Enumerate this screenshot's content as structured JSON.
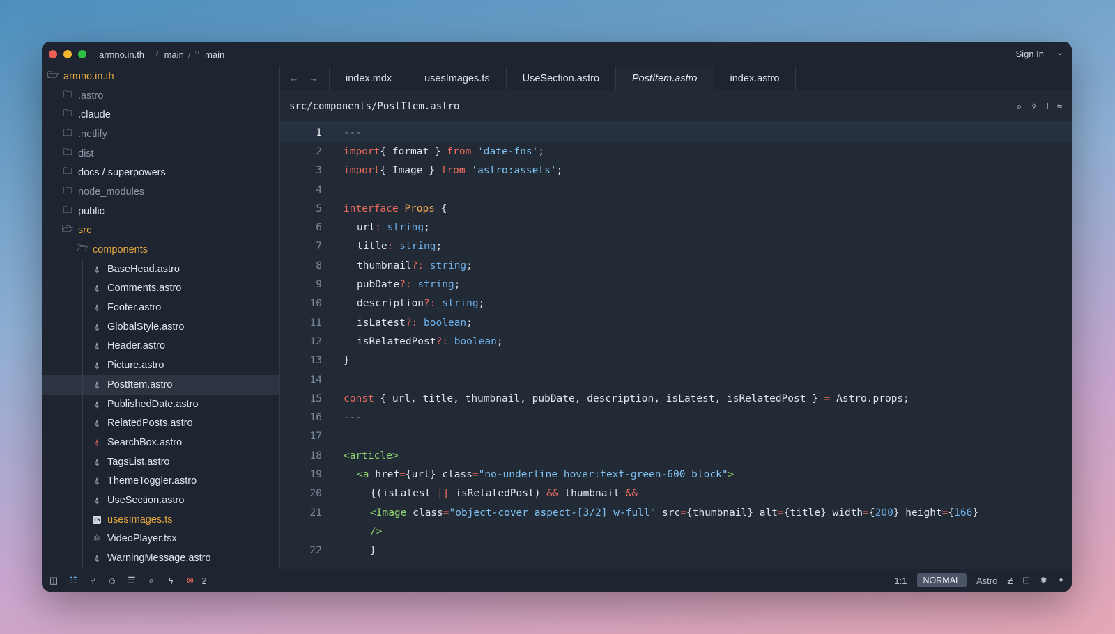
{
  "window": {
    "traffic_lights": [
      "#ed5f56",
      "#f2b92d",
      "#2fbf47"
    ],
    "project": "armno.in.th",
    "branch1": "main",
    "branch_sep": "/",
    "branch2": "main",
    "sign_in": "Sign In"
  },
  "sidebar": {
    "root": "armno.in.th",
    "items": [
      {
        "label": ".astro",
        "kind": "folder",
        "style": "muted"
      },
      {
        "label": ".claude",
        "kind": "folder"
      },
      {
        "label": ".netlify",
        "kind": "folder",
        "style": "muted"
      },
      {
        "label": "dist",
        "kind": "folder",
        "style": "muted"
      },
      {
        "label": "docs / superpowers",
        "kind": "folder"
      },
      {
        "label": "node_modules",
        "kind": "folder",
        "style": "muted"
      },
      {
        "label": "public",
        "kind": "folder"
      },
      {
        "label": "src",
        "kind": "folder-open",
        "style": "orange"
      },
      {
        "label": "components",
        "kind": "folder-open",
        "style": "orange"
      },
      {
        "label": "BaseHead.astro",
        "kind": "astro"
      },
      {
        "label": "Comments.astro",
        "kind": "astro"
      },
      {
        "label": "Footer.astro",
        "kind": "astro"
      },
      {
        "label": "GlobalStyle.astro",
        "kind": "astro"
      },
      {
        "label": "Header.astro",
        "kind": "astro"
      },
      {
        "label": "Picture.astro",
        "kind": "astro"
      },
      {
        "label": "PostItem.astro",
        "kind": "astro",
        "selected": true
      },
      {
        "label": "PublishedDate.astro",
        "kind": "astro"
      },
      {
        "label": "RelatedPosts.astro",
        "kind": "astro"
      },
      {
        "label": "SearchBox.astro",
        "kind": "astro-error"
      },
      {
        "label": "TagsList.astro",
        "kind": "astro"
      },
      {
        "label": "ThemeToggler.astro",
        "kind": "astro"
      },
      {
        "label": "UseSection.astro",
        "kind": "astro"
      },
      {
        "label": "usesImages.ts",
        "kind": "ts",
        "style": "orange"
      },
      {
        "label": "VideoPlayer.tsx",
        "kind": "react"
      },
      {
        "label": "WarningMessage.astro",
        "kind": "astro"
      }
    ]
  },
  "tabs": [
    {
      "label": "index.mdx"
    },
    {
      "label": "usesImages.ts"
    },
    {
      "label": "UseSection.astro"
    },
    {
      "label": "PostItem.astro",
      "active": true
    },
    {
      "label": "index.astro"
    }
  ],
  "breadcrumb": "src/components/PostItem.astro",
  "code": [
    {
      "n": "1",
      "indent": 0,
      "tokens": [
        [
          "dim",
          "---"
        ]
      ],
      "current": true
    },
    {
      "n": "2",
      "indent": 0,
      "tokens": [
        [
          "kw",
          "import"
        ],
        [
          "",
          "{ format } "
        ],
        [
          "kw",
          "from"
        ],
        [
          "",
          " "
        ],
        [
          "str",
          "'date-fns'"
        ],
        [
          "",
          ";"
        ]
      ]
    },
    {
      "n": "3",
      "indent": 0,
      "tokens": [
        [
          "kw",
          "import"
        ],
        [
          "",
          "{ Image } "
        ],
        [
          "kw",
          "from"
        ],
        [
          "",
          " "
        ],
        [
          "str",
          "'astro:assets'"
        ],
        [
          "",
          ";"
        ]
      ]
    },
    {
      "n": "4",
      "indent": 0,
      "tokens": []
    },
    {
      "n": "5",
      "indent": 0,
      "tokens": [
        [
          "kw",
          "interface"
        ],
        [
          "",
          " "
        ],
        [
          "cls",
          "Props"
        ],
        [
          "",
          " {"
        ]
      ]
    },
    {
      "n": "6",
      "indent": 1,
      "tokens": [
        [
          "",
          "url"
        ],
        [
          "op",
          ":"
        ],
        [
          "",
          " "
        ],
        [
          "typ",
          "string"
        ],
        [
          "",
          ";"
        ]
      ]
    },
    {
      "n": "7",
      "indent": 1,
      "tokens": [
        [
          "",
          "title"
        ],
        [
          "op",
          ":"
        ],
        [
          "",
          " "
        ],
        [
          "typ",
          "string"
        ],
        [
          "",
          ";"
        ]
      ]
    },
    {
      "n": "8",
      "indent": 1,
      "tokens": [
        [
          "",
          "thumbnail"
        ],
        [
          "op",
          "?:"
        ],
        [
          "",
          " "
        ],
        [
          "typ",
          "string"
        ],
        [
          "",
          ";"
        ]
      ]
    },
    {
      "n": "9",
      "indent": 1,
      "tokens": [
        [
          "",
          "pubDate"
        ],
        [
          "op",
          "?:"
        ],
        [
          "",
          " "
        ],
        [
          "typ",
          "string"
        ],
        [
          "",
          ";"
        ]
      ]
    },
    {
      "n": "10",
      "indent": 1,
      "tokens": [
        [
          "",
          "description"
        ],
        [
          "op",
          "?:"
        ],
        [
          "",
          " "
        ],
        [
          "typ",
          "string"
        ],
        [
          "",
          ";"
        ]
      ]
    },
    {
      "n": "11",
      "indent": 1,
      "tokens": [
        [
          "",
          "isLatest"
        ],
        [
          "op",
          "?:"
        ],
        [
          "",
          " "
        ],
        [
          "typ",
          "boolean"
        ],
        [
          "",
          ";"
        ]
      ]
    },
    {
      "n": "12",
      "indent": 1,
      "tokens": [
        [
          "",
          "isRelatedPost"
        ],
        [
          "op",
          "?:"
        ],
        [
          "",
          " "
        ],
        [
          "typ",
          "boolean"
        ],
        [
          "",
          ";"
        ]
      ]
    },
    {
      "n": "13",
      "indent": 0,
      "tokens": [
        [
          "",
          "}"
        ]
      ]
    },
    {
      "n": "14",
      "indent": 0,
      "tokens": []
    },
    {
      "n": "15",
      "indent": 0,
      "tokens": [
        [
          "kw",
          "const"
        ],
        [
          "",
          " { url, title, thumbnail, pubDate, description, isLatest, isRelatedPost } "
        ],
        [
          "op",
          "="
        ],
        [
          "",
          " Astro.props;"
        ]
      ]
    },
    {
      "n": "16",
      "indent": 0,
      "tokens": [
        [
          "dim",
          "---"
        ]
      ]
    },
    {
      "n": "17",
      "indent": 0,
      "tokens": []
    },
    {
      "n": "18",
      "indent": 0,
      "tokens": [
        [
          "tag",
          "<article>"
        ]
      ]
    },
    {
      "n": "19",
      "indent": 1,
      "tokens": [
        [
          "tag",
          "<a"
        ],
        [
          "",
          " href"
        ],
        [
          "op",
          "="
        ],
        [
          "",
          "{url} class"
        ],
        [
          "op",
          "="
        ],
        [
          "str",
          "\"no-underline hover:text-green-600 block\""
        ],
        [
          "tag",
          ">"
        ]
      ]
    },
    {
      "n": "20",
      "indent": 2,
      "tokens": [
        [
          "",
          "{(isLatest "
        ],
        [
          "op",
          "||"
        ],
        [
          "",
          " isRelatedPost) "
        ],
        [
          "op",
          "&&"
        ],
        [
          "",
          " thumbnail "
        ],
        [
          "op",
          "&&"
        ]
      ]
    },
    {
      "n": "21",
      "indent": 2,
      "tokens": [
        [
          "tag",
          "<Image"
        ],
        [
          "",
          " class"
        ],
        [
          "op",
          "="
        ],
        [
          "str",
          "\"object-cover aspect-[3/2] w-full\""
        ],
        [
          "",
          " src"
        ],
        [
          "op",
          "="
        ],
        [
          "",
          "{thumbnail} alt"
        ],
        [
          "op",
          "="
        ],
        [
          "",
          "{title} width"
        ],
        [
          "op",
          "="
        ],
        [
          "",
          "{"
        ],
        [
          "num",
          "200"
        ],
        [
          "",
          "} height"
        ],
        [
          "op",
          "="
        ],
        [
          "",
          "{"
        ],
        [
          "num",
          "166"
        ],
        [
          "",
          "}"
        ]
      ]
    },
    {
      "n": "",
      "indent": 2,
      "tokens": [
        [
          "tag",
          "/>"
        ]
      ]
    },
    {
      "n": "22",
      "indent": 2,
      "tokens": [
        [
          "",
          "}"
        ]
      ]
    }
  ],
  "status": {
    "error_count": "2",
    "cursor": "1:1",
    "mode": "NORMAL",
    "language": "Astro"
  }
}
